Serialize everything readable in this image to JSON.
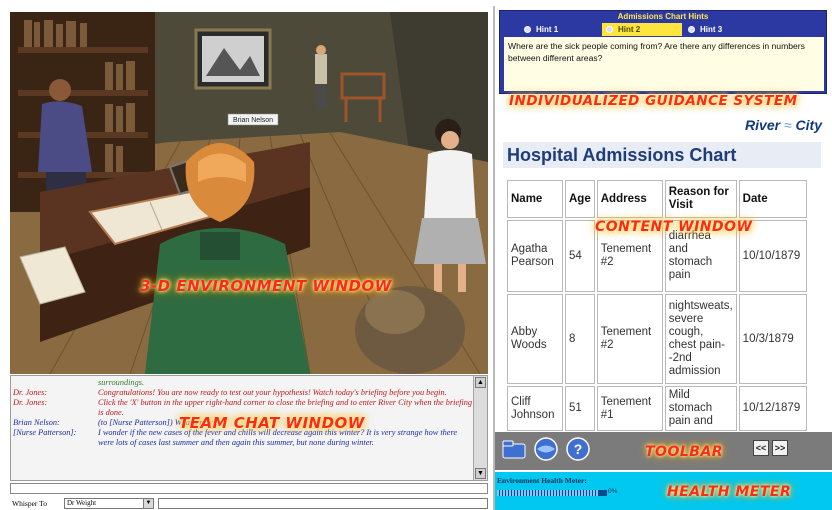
{
  "world": {
    "avatar_nametag": "Brian Nelson",
    "overlay_label": "3-D ENVIRONMENT WINDOW"
  },
  "chat": {
    "overlay_label": "TEAM CHAT WINDOW",
    "messages": [
      {
        "speaker": "",
        "text": "surroundings.",
        "color": "green"
      },
      {
        "speaker": "Dr. Jones:",
        "text": "Congratulations!  You are now ready to test out your hypothesis! Watch today's briefing before you begin.",
        "color": "red"
      },
      {
        "speaker": "Dr. Jones:",
        "text": "Click the 'X' button in the upper right-hand corner to close the briefing and to enter River City when the briefing is done.",
        "color": "red"
      },
      {
        "speaker": "Brian Nelson:",
        "text": "(to [Nurse Patterson]) What's new?",
        "color": "blue"
      },
      {
        "speaker": "[Nurse Patterson]:",
        "text": "I wonder if the new cases of the fever and chills will decrease again this winter?  It is very strange how there were lots of cases last summer and then again this summer, but none during winter.",
        "color": "blue"
      }
    ],
    "whisper_label": "Whisper To",
    "whisper_target": "Dr Weight"
  },
  "hints": {
    "title": "Admissions Chart Hints",
    "tabs": [
      {
        "label": "Hint 1",
        "active": false
      },
      {
        "label": "Hint 2",
        "active": true
      },
      {
        "label": "Hint 3",
        "active": false
      }
    ],
    "text": "Where are the sick people coming from? Are there any differences in numbers between different areas?",
    "overlay_label": "INDIVIDUALIZED GUIDANCE SYSTEM"
  },
  "brand": {
    "left": "River",
    "right": "City"
  },
  "content": {
    "title": "Hospital Admissions Chart",
    "overlay_label": "CONTENT WINDOW",
    "columns": [
      "Name",
      "Age",
      "Address",
      "Reason for Visit",
      "Date"
    ],
    "rows": [
      {
        "name": "Agatha Pearson",
        "age": "54",
        "address": "Tenement #2",
        "reason": "diarrhea and stomach pain",
        "date": "10/10/1879"
      },
      {
        "name": "Abby Woods",
        "age": "8",
        "address": "Tenement #2",
        "reason": "nightsweats, severe cough, chest pain--2nd admission",
        "date": "10/3/1879"
      },
      {
        "name": "Cliff Johnson",
        "age": "51",
        "address": "Tenement #1",
        "reason": "Mild stomach pain and",
        "date": "10/12/1879"
      }
    ]
  },
  "toolbar": {
    "overlay_label": "TOOLBAR",
    "prev_label": "<<",
    "next_label": ">>"
  },
  "health": {
    "label": "Environment Health Meter:",
    "percent_text": "0%",
    "level": 0.92,
    "overlay_label": "HEALTH METER"
  },
  "colors": {
    "overlay_text": "#ff2a12",
    "hint_panel": "#2d39a3",
    "hint_active": "#ffe43d",
    "toolbar": "#7b7b7b",
    "health_bg": "#00c8f0"
  }
}
